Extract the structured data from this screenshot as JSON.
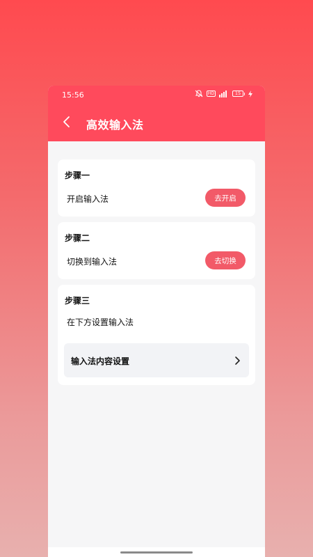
{
  "status_bar": {
    "time": "15:56",
    "hd_label": "HD",
    "battery_level": "15"
  },
  "header": {
    "title": "高效输入法"
  },
  "steps": [
    {
      "title": "步骤一",
      "label": "开启输入法",
      "button": "去开启"
    },
    {
      "title": "步骤二",
      "label": "切换到输入法",
      "button": "去切换"
    },
    {
      "title": "步骤三",
      "label": "在下方设置输入法",
      "setting_label": "输入法内容设置"
    }
  ],
  "colors": {
    "accent": "#ff4a5c",
    "button": "#f25a68",
    "background": "#f6f6f7"
  }
}
